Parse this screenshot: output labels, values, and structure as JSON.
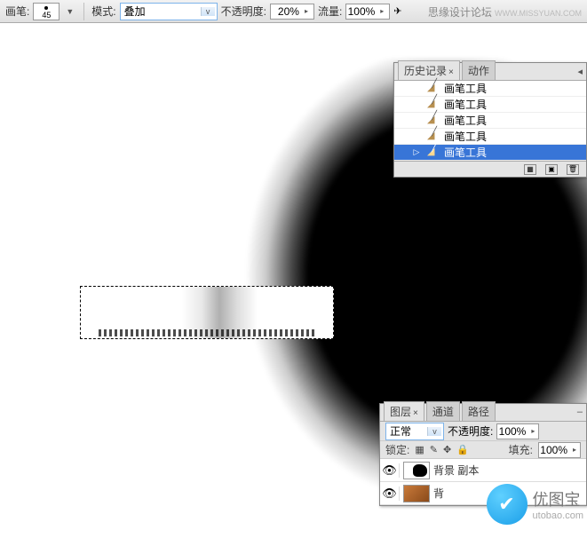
{
  "toolbar": {
    "brush_label": "画笔:",
    "brush_size": "45",
    "mode_label": "模式:",
    "mode_value": "叠加",
    "opacity_label": "不透明度:",
    "opacity_value": "20%",
    "flow_label": "流量:",
    "flow_value": "100%",
    "forum_text": "思缘设计论坛",
    "forum_url": "WWW.MISSYUAN.COM"
  },
  "history": {
    "tab_history": "历史记录",
    "tab_actions": "动作",
    "items": [
      {
        "label": "画笔工具",
        "active": false
      },
      {
        "label": "画笔工具",
        "active": false
      },
      {
        "label": "画笔工具",
        "active": false
      },
      {
        "label": "画笔工具",
        "active": false
      },
      {
        "label": "画笔工具",
        "active": true
      }
    ]
  },
  "layers": {
    "tab_layers": "图层",
    "tab_channels": "通道",
    "tab_paths": "路径",
    "blend_value": "正常",
    "opacity_label": "不透明度:",
    "opacity_value": "100%",
    "lock_label": "锁定:",
    "fill_label": "填充:",
    "fill_value": "100%",
    "rows": [
      {
        "name": "背景 副本"
      },
      {
        "name": "背"
      }
    ]
  },
  "watermark": {
    "name": "优图宝",
    "url": "utobao.com"
  }
}
